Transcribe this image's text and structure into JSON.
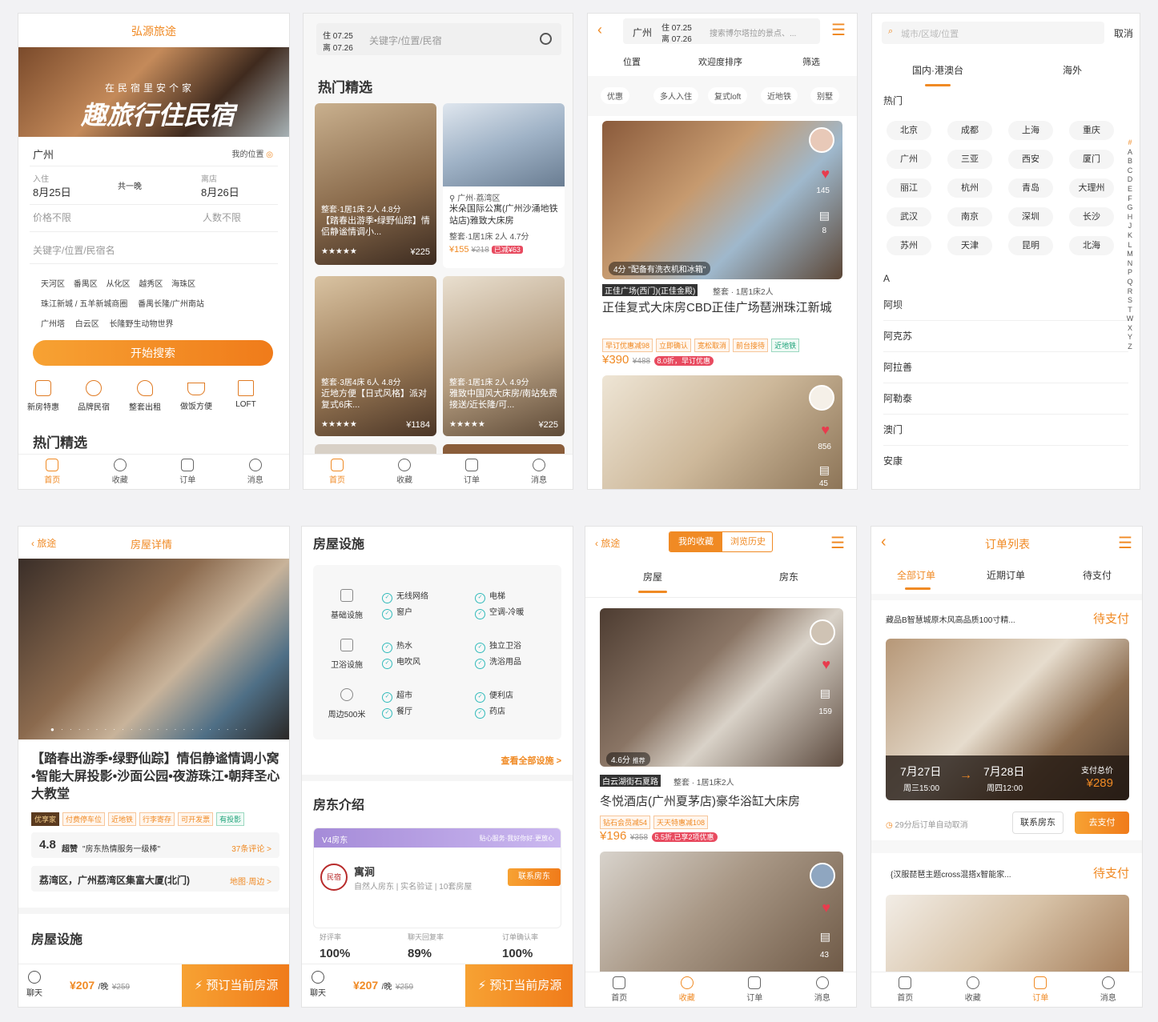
{
  "s1": {
    "title": "弘源旅途",
    "banner_small": "在民宿里安个家",
    "banner_big": "趣旅行住民宿",
    "city": "广州",
    "my_location": "我的位置",
    "checkin_label": "入住",
    "checkin_date": "8月25日",
    "nights": "共一晚",
    "checkout_label": "离店",
    "checkout_date": "8月26日",
    "price_label": "价格不限",
    "people_label": "人数不限",
    "keyword_placeholder": "关键字/位置/民宿名",
    "districts": [
      "天河区",
      "番禺区",
      "从化区",
      "越秀区",
      "海珠区",
      "珠江新城 / 五羊新城商圈",
      "番禺长隆/广州南站",
      "广州塔",
      "白云区",
      "长隆野生动物世界"
    ],
    "search_button": "开始搜索",
    "categories": [
      "新房特惠",
      "品牌民宿",
      "整套出租",
      "做饭方便",
      "LOFT"
    ],
    "hot_title": "热门精选"
  },
  "tabs": {
    "home": "首页",
    "fav": "收藏",
    "order": "订单",
    "msg": "消息"
  },
  "s2": {
    "date_in": "住 07.25",
    "date_out": "离 07.26",
    "search_placeholder": "关键字/位置/民宿",
    "hot_title": "热门精选",
    "card1": {
      "meta": "整套·1居1床 2人 4.8分",
      "title": "【踏春出游季•绿野仙踪】情侣静谧情调小...",
      "price": "¥225"
    },
    "card2": {
      "loc": "广州·荔湾区",
      "title": "米朵国际公寓(广州沙涌地铁站店)雅致大床房",
      "meta": "整套·1居1床 2人 4.7分",
      "price": "¥155",
      "old": "¥218",
      "badge": "已减¥63"
    },
    "card3": {
      "meta": "整套·3居4床 6人 4.8分",
      "title": "近地方便【日式风格】派对复式6床...",
      "price": "¥1184"
    },
    "card4": {
      "meta": "整套·1居1床 2人 4.9分",
      "title": "雅致中国风大床房/南站免费接送/近长隆/可...",
      "price": "¥225"
    }
  },
  "s3": {
    "city": "广州",
    "date_in": "住 07.25",
    "date_out": "离 07.26",
    "search_placeholder": "搜索博尔塔拉的景点、...",
    "filters": [
      "位置",
      "欢迎度排序",
      "筛选"
    ],
    "chips": [
      "优惠",
      "多人入住",
      "复式loft",
      "近地铁",
      "别墅"
    ],
    "l1": {
      "score": "4分 \"配备有洗衣机和冰箱\"",
      "likes": "145",
      "comments": "8",
      "tag": "正佳广场(西门)(正佳金殿)",
      "meta": "整套 · 1居1床2人",
      "title": "正佳复式大床房CBD正佳广场琶洲珠江新城",
      "tags": [
        "早订优惠减98",
        "立即确认",
        "宽松取消",
        "前台接待",
        "近地铁"
      ],
      "price": "¥390",
      "old": "¥488",
      "badge": "8.0折，早订优惠"
    },
    "l2": {
      "likes": "856",
      "comments": "45"
    }
  },
  "s4": {
    "search_placeholder": "城市/区域/位置",
    "cancel": "取消",
    "tab_domestic": "国内·港澳台",
    "tab_abroad": "海外",
    "hot_label": "热门",
    "cities": [
      "北京",
      "成都",
      "上海",
      "重庆",
      "广州",
      "三亚",
      "西安",
      "厦门",
      "丽江",
      "杭州",
      "青岛",
      "大理州",
      "武汉",
      "南京",
      "深圳",
      "长沙",
      "苏州",
      "天津",
      "昆明",
      "北海"
    ],
    "letter_a": "A",
    "a_cities": [
      "阿坝",
      "阿克苏",
      "阿拉善",
      "阿勒泰",
      "澳门",
      "安康"
    ],
    "index": [
      "#",
      "A",
      "B",
      "C",
      "D",
      "E",
      "F",
      "G",
      "H",
      "J",
      "K",
      "L",
      "M",
      "N",
      "P",
      "Q",
      "R",
      "S",
      "T",
      "W",
      "X",
      "Y",
      "Z"
    ]
  },
  "s5": {
    "back": "旅途",
    "title": "房屋详情",
    "name": "【踏春出游季•绿野仙踪】情侣静谧情调小窝•智能大屏投影•沙面公园•夜游珠江•朝拜圣心大教堂",
    "tags": [
      "优享家",
      "付费停车位",
      "近地铁",
      "行李寄存",
      "可开发票",
      "有投影"
    ],
    "score": "4.8",
    "score_word": "超赞",
    "review_quote": "\"房东热情服务一级棒\"",
    "review_count": "37条评论 >",
    "address": "荔湾区，广州荔湾区集富大厦(北门)",
    "map": "地图·周边 >",
    "facilities_title": "房屋设施",
    "chat": "聊天",
    "price": "¥207",
    "unit": "/晚",
    "old": "¥259",
    "book": "预订当前房源"
  },
  "s6": {
    "title": "房屋设施",
    "groups": [
      {
        "name": "基础设施",
        "items": [
          "无线网络",
          "窗户",
          "电梯",
          "空调-冷暖"
        ]
      },
      {
        "name": "卫浴设施",
        "items": [
          "热水",
          "电吹风",
          "独立卫浴",
          "洗浴用品"
        ]
      },
      {
        "name": "周边500米",
        "items": [
          "超市",
          "餐厅",
          "便利店",
          "药店"
        ]
      }
    ],
    "see_all": "查看全部设施 >",
    "host_title": "房东介绍",
    "host_level": "V4房东",
    "host_slogan": "贴心服务·我好你好·更放心",
    "host_name": "寓涧",
    "host_desc": "自然人房东 | 实名验证 | 10套房屋",
    "contact": "联系房东",
    "host_logo": "民宿",
    "stats": [
      {
        "label": "好评率",
        "value": "100%"
      },
      {
        "label": "聊天回复率",
        "value": "89%"
      },
      {
        "label": "订单确认率",
        "value": "100%"
      }
    ],
    "chat": "聊天",
    "price": "¥207",
    "unit": "/晚",
    "old": "¥259",
    "book": "预订当前房源"
  },
  "s7": {
    "back": "旅途",
    "tab_fav": "我的收藏",
    "tab_hist": "浏览历史",
    "sub_house": "房屋",
    "sub_host": "房东",
    "score": "4.6分",
    "score_tag": "推荐",
    "likes": "159",
    "tag": "白云湖街石夏路",
    "meta": "整套 · 1居1床2人",
    "title": "冬悦酒店(广州夏茅店)豪华浴缸大床房",
    "tags": [
      "钻石会员减54",
      "天天特惠减108"
    ],
    "price": "¥196",
    "old": "¥358",
    "badge": "5.5折,已享2项优惠",
    "likes2": "43"
  },
  "s8": {
    "title": "订单列表",
    "tabs": [
      "全部订单",
      "近期订单",
      "待支付"
    ],
    "o1": {
      "name": "藏品B智慧城原木风高品质100寸精...",
      "status": "待支付",
      "in_date": "7月27日",
      "in_time": "周三15:00",
      "out_date": "7月28日",
      "out_time": "周四12:00",
      "total_label": "支付总价",
      "total": "¥289",
      "countdown": "29分后订单自动取消",
      "contact": "联系房东",
      "pay": "去支付"
    },
    "o2": {
      "name": "{汉服琵琶主题cross混搭x智能家...",
      "status": "待支付"
    }
  }
}
